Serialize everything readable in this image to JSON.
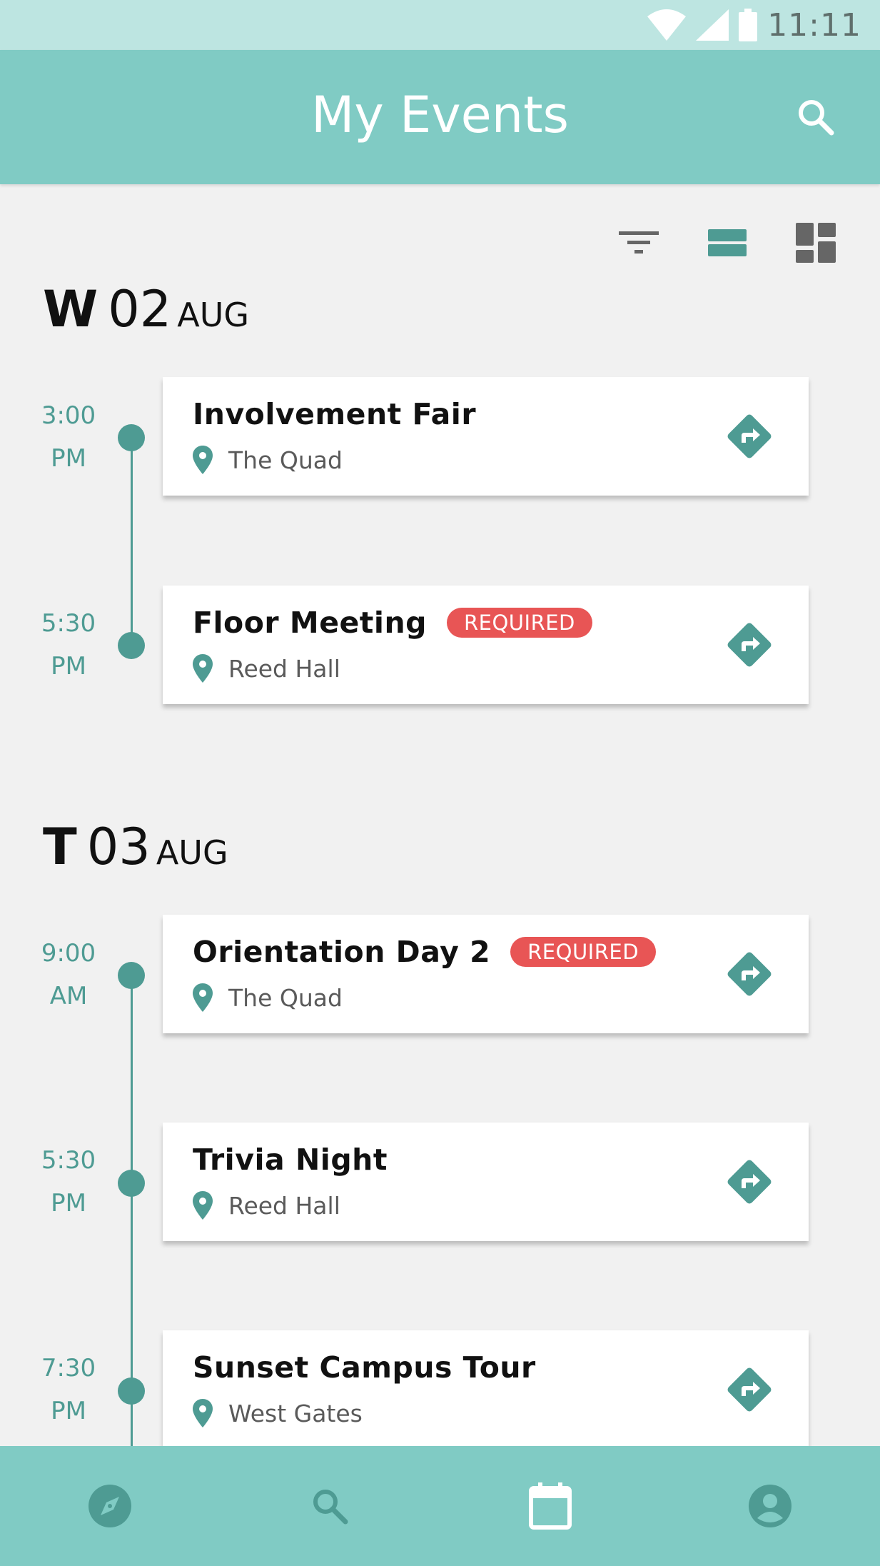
{
  "status_bar": {
    "time": "11:11",
    "icons": [
      "wifi-icon",
      "signal-icon",
      "battery-icon"
    ]
  },
  "app_bar": {
    "title": "My Events",
    "search_icon": "search-icon"
  },
  "view_toggles": [
    "filter-icon",
    "list-view-icon",
    "grid-view-icon"
  ],
  "colors": {
    "accent": "#80cbc4",
    "teal": "#4e9b93",
    "required": "#e85555",
    "background": "#f1f1f1"
  },
  "days": [
    {
      "letter": "W",
      "num": "02",
      "month": "AUG",
      "events": [
        {
          "time": "3:00",
          "ampm": "PM",
          "title": "Involvement Fair",
          "required": "",
          "location": "The Quad"
        },
        {
          "time": "5:30",
          "ampm": "PM",
          "title": "Floor Meeting",
          "required": "REQUIRED",
          "location": "Reed Hall"
        }
      ]
    },
    {
      "letter": "T",
      "num": "03",
      "month": "AUG",
      "events": [
        {
          "time": "9:00",
          "ampm": "AM",
          "title": "Orientation Day 2",
          "required": "REQUIRED",
          "location": "The Quad"
        },
        {
          "time": "5:30",
          "ampm": "PM",
          "title": "Trivia Night",
          "required": "",
          "location": "Reed Hall"
        },
        {
          "time": "7:30",
          "ampm": "PM",
          "title": "Sunset Campus Tour",
          "required": "",
          "location": "West Gates"
        }
      ]
    }
  ],
  "bottom_nav": [
    "explore-icon",
    "search-icon",
    "calendar-icon",
    "account-icon"
  ]
}
